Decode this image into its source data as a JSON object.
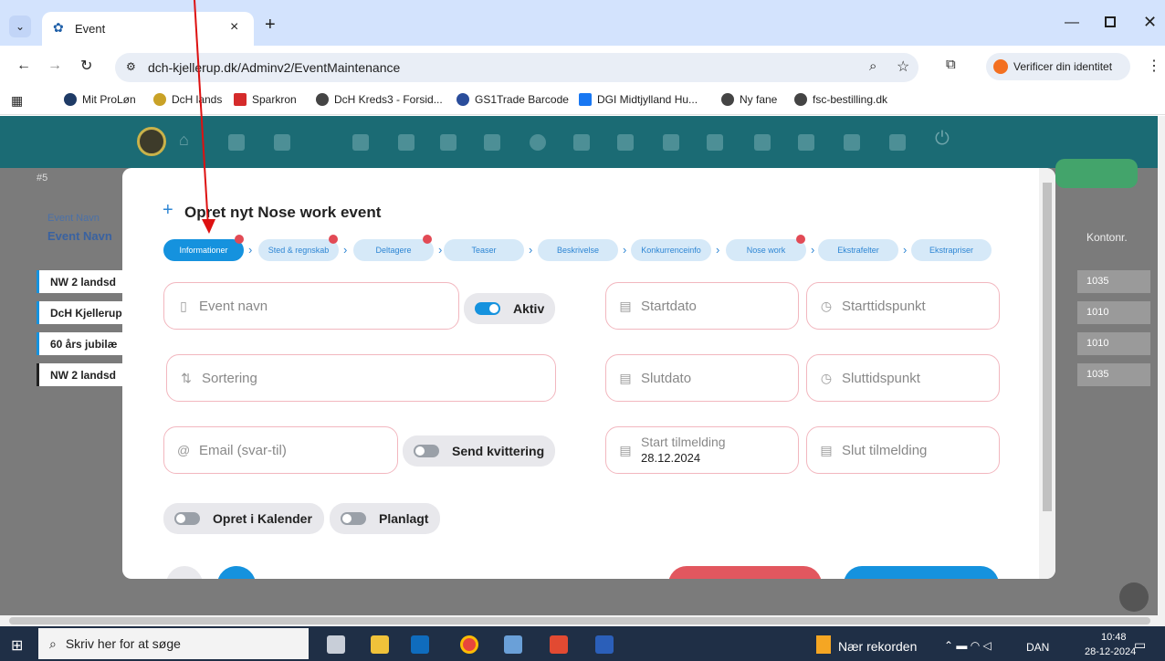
{
  "browser": {
    "tab_title": "Event",
    "url": "dch-kjellerup.dk/Adminv2/EventMaintenance",
    "profile_label": "Verificer din identitet",
    "bookmarks": [
      "Mit ProLøn",
      "DcH lands",
      "Sparkron",
      "DcH Kreds3 - Forsid...",
      "GS1Trade Barcode",
      "DGI Midtjylland Hu...",
      "Ny fane",
      "fsc-bestilling.dk"
    ]
  },
  "background": {
    "header_lines": [
      "#5",
      "Event Navn",
      "Event Navn"
    ],
    "rows": [
      "NW 2 landsd",
      "DcH Kjellerup",
      "60 års jubilæ",
      "NW 2 landsd"
    ],
    "kontonr_header": "Kontonr.",
    "kontonr_values": [
      "1035",
      "1010",
      "1010",
      "1035"
    ]
  },
  "modal": {
    "title": "Opret nyt Nose work event",
    "steps": [
      "Informationer",
      "Sted & regnskab",
      "Deltagere",
      "Teaser",
      "Beskrivelse",
      "Konkurrenceinfo",
      "Nose work",
      "Ekstrafelter",
      "Ekstrapriser"
    ],
    "fields": {
      "event_navn": "Event navn",
      "sortering": "Sortering",
      "email": "Email (svar-til)",
      "startdato": "Startdato",
      "starttidspunkt": "Starttidspunkt",
      "slutdato": "Slutdato",
      "sluttidspunkt": "Sluttidspunkt",
      "start_tilmelding_label": "Start tilmelding",
      "start_tilmelding_value": "28.12.2024",
      "slut_tilmelding": "Slut tilmelding"
    },
    "toggles": {
      "aktiv": "Aktiv",
      "send_kvittering": "Send kvittering",
      "opret_kalender": "Opret i Kalender",
      "planlagt": "Planlagt"
    }
  },
  "taskbar": {
    "search_placeholder": "Skriv her for at søge",
    "weather": "Nær rekorden",
    "language": "DAN",
    "time": "10:48",
    "date": "28-12-2024"
  }
}
